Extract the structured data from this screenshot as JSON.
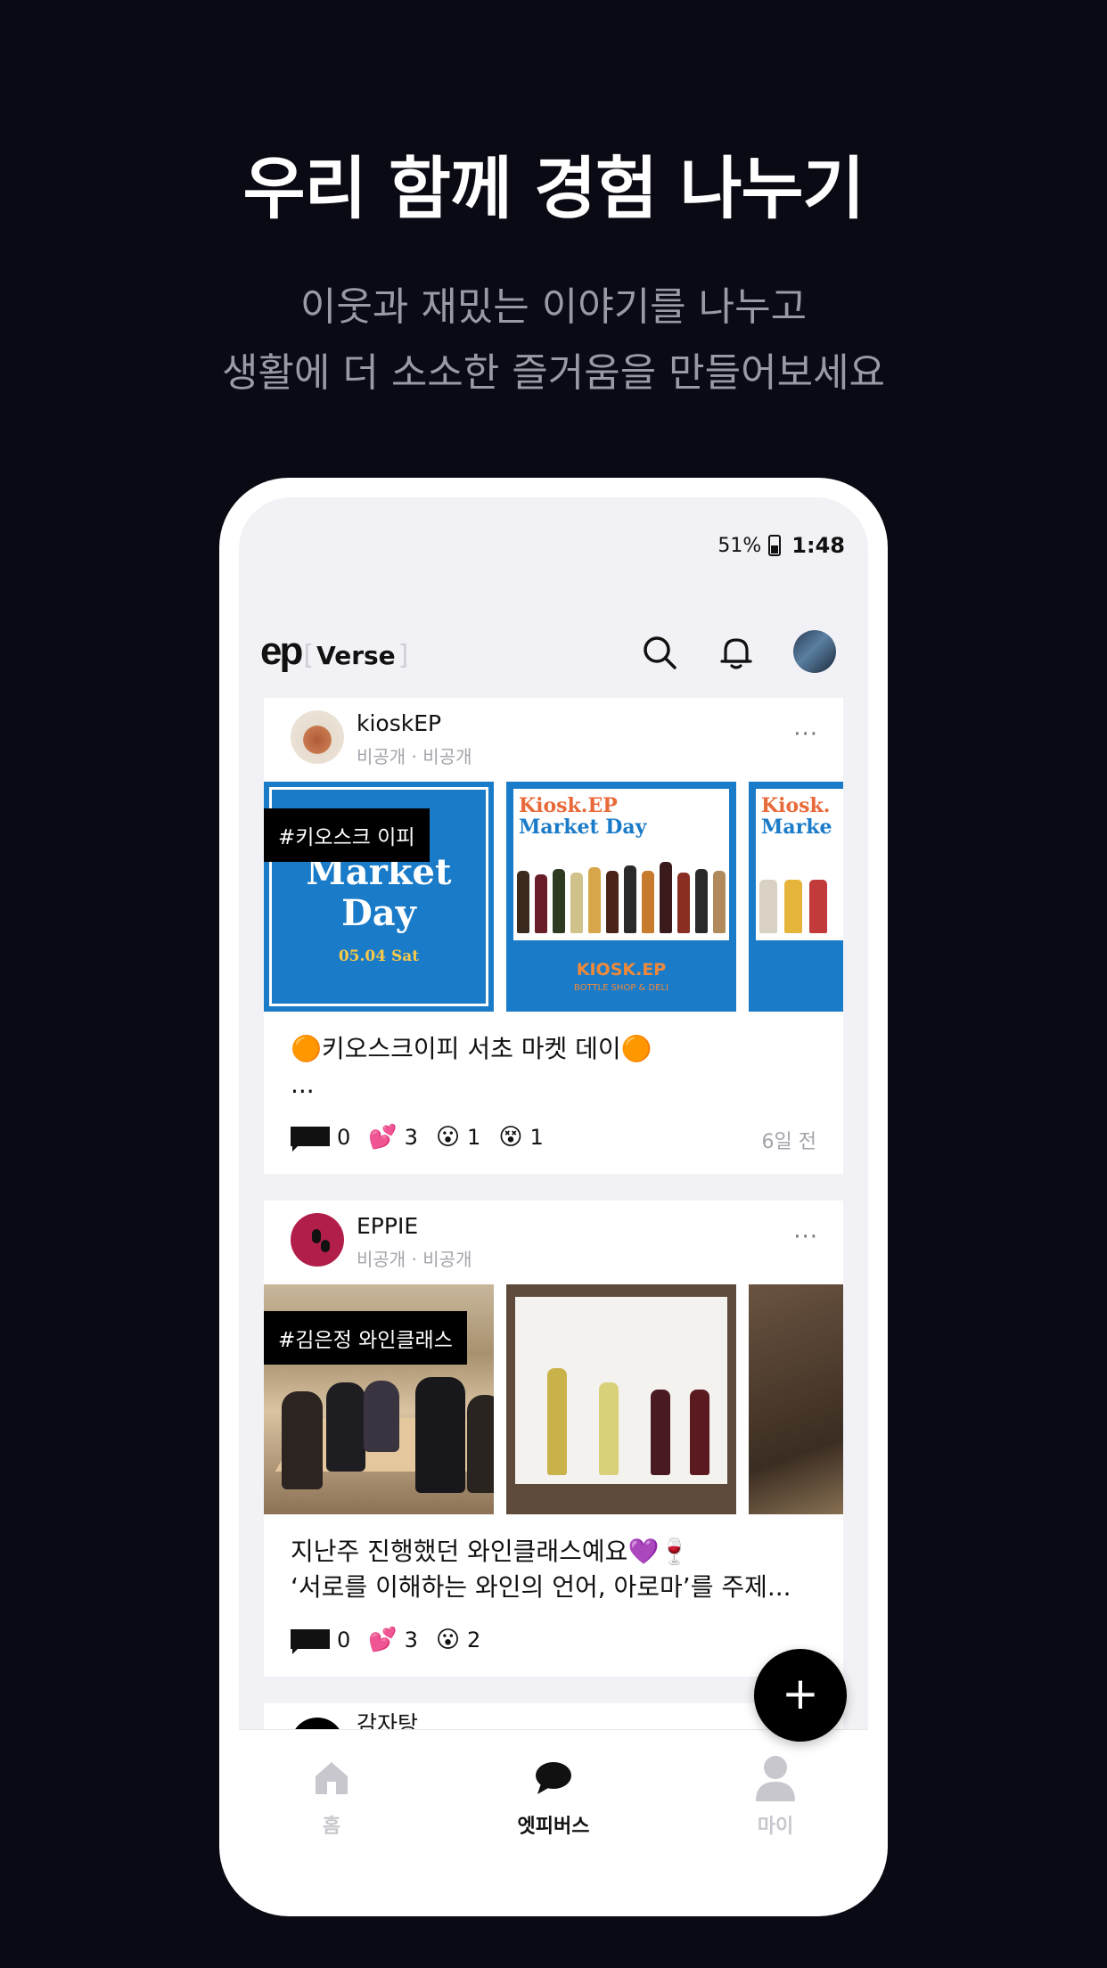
{
  "promo": {
    "title": "우리 함께 경험 나누기",
    "subtitle_line1": "이웃과 재밌는 이야기를 나누고",
    "subtitle_line2": "생활에 더 소소한 즐거움을 만들어보세요"
  },
  "status_bar": {
    "battery": "51%",
    "time": "1:48"
  },
  "header": {
    "logo_ep": "ep",
    "logo_bracket_open": "[",
    "logo_verse": "Verse",
    "logo_bracket_close": "]",
    "icons": [
      "search-icon",
      "bell-icon"
    ]
  },
  "posts": [
    {
      "author": "kioskEP",
      "meta": "비공개 · 비공개",
      "more": "···",
      "tag": "#키오스크 이피",
      "poster_title_1": "Market",
      "poster_title_2": "Day",
      "poster_date": "05.04 Sat",
      "poster2_title_1": "Kiosk.EP",
      "poster2_title_2": "Market Day",
      "poster2_brand": "KIOSK.EP",
      "poster2_brand_sub": "BOTTLE SHOP & DELI",
      "poster3_title_1": "Kiosk.",
      "poster3_title_2": "Marke",
      "text_line1": "🟠키오스크이피 서초 마켓 데이🟠",
      "text_line2": "...",
      "comments": "0",
      "reactions": [
        {
          "emoji": "💕",
          "count": "3"
        },
        {
          "emoji": "😮",
          "count": "1"
        },
        {
          "emoji": "😵",
          "count": "1"
        }
      ],
      "ago": "6일 전"
    },
    {
      "author": "EPPIE",
      "meta": "비공개 · 비공개",
      "more": "···",
      "tag": "#김은정 와인클래스",
      "text_line1": "지난주 진행했던 와인클래스예요💜🍷",
      "text_line2": "‘서로를 이해하는 와인의 언어, 아로마’를 주제...",
      "comments": "0",
      "reactions": [
        {
          "emoji": "💕",
          "count": "3"
        },
        {
          "emoji": "😮",
          "count": "2"
        }
      ],
      "ago": ""
    },
    {
      "author": "감자탕"
    }
  ],
  "fab": {
    "label": "+"
  },
  "tabbar": {
    "home": "홈",
    "verse": "엣피버스",
    "my": "마이",
    "active": "verse"
  },
  "colors": {
    "background": "#0a0a14",
    "poster_blue": "#1a7bc8",
    "poster_orange": "#e86a3a",
    "eppie_red": "#b21e4a"
  }
}
